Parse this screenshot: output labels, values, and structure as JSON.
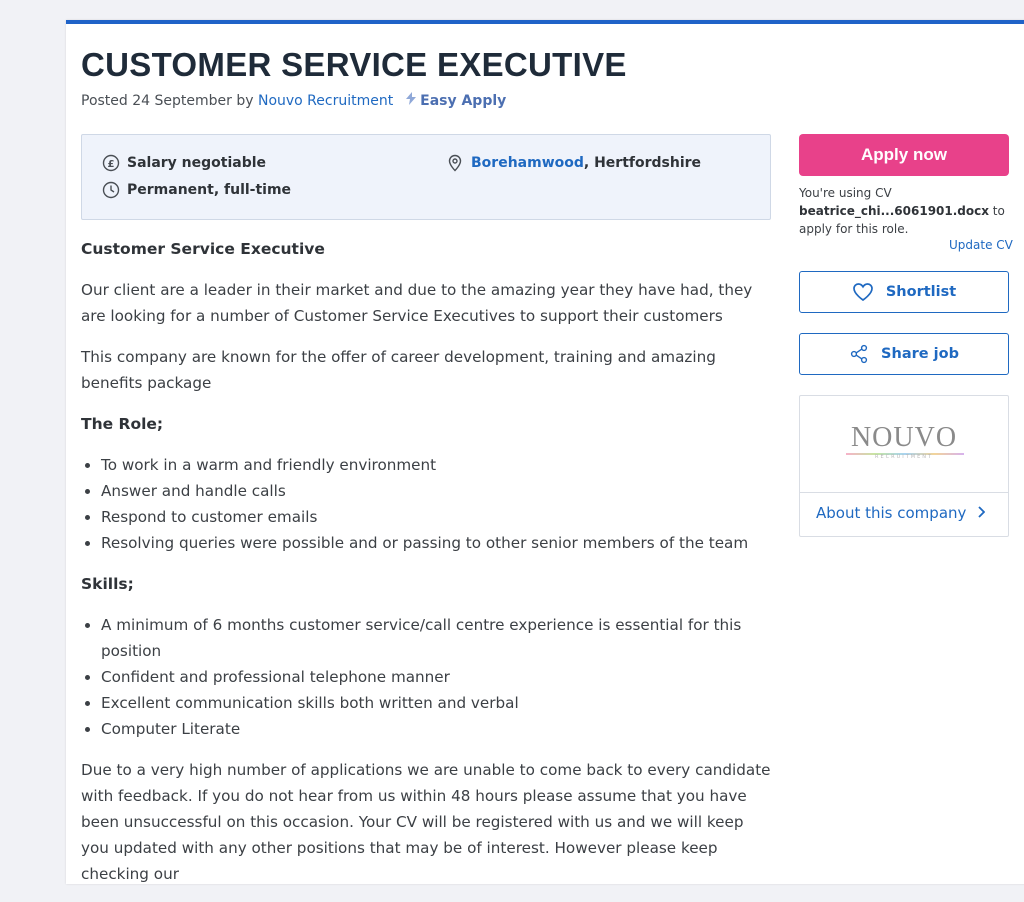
{
  "job": {
    "title": "CUSTOMER SERVICE EXECUTIVE",
    "posted_prefix": "Posted 24 September by ",
    "recruiter": "Nouvo Recruitment",
    "easy_apply": "Easy Apply"
  },
  "summary": {
    "salary": "Salary negotiable",
    "contract": "Permanent, full-time",
    "location_town": "Borehamwood",
    "location_region": ", Hertfordshire"
  },
  "description": {
    "heading": "Customer Service Executive",
    "intro": "Our client are a leader in their market and due to the amazing year they have had, they are looking for a number of Customer Service Executives to support their customers",
    "company_para": "This company are known for the offer of career development, training and amazing benefits package",
    "role_heading": "The Role;",
    "role_items": [
      "To work in a warm and friendly environment",
      "Answer and handle calls",
      "Respond to customer emails",
      "Resolving queries were possible and or passing to other senior members of the team"
    ],
    "skills_heading": "Skills;",
    "skills_items": [
      "A minimum of 6 months customer service/call centre experience is essential for this position",
      "Confident and professional telephone manner",
      "Excellent communication skills both written and verbal",
      "Computer Literate"
    ],
    "closing": "Due to a very high number of applications we are unable to come back to every candidate with feedback. If you do not hear from us within 48 hours please assume that you have been unsuccessful on this occasion. Your CV will be registered with us and we will keep you updated with any other positions that may be of interest. However please keep checking our"
  },
  "sidebar": {
    "apply_label": "Apply now",
    "cv_prefix": "You're using CV ",
    "cv_file": "beatrice_chi...6061901.docx",
    "cv_suffix": " to apply for this role.",
    "update_cv": "Update CV",
    "shortlist_label": "Shortlist",
    "share_label": "Share job",
    "company_logo_text": "NOUVO",
    "company_logo_sub": "RECRUITMENT",
    "about_company": "About this company"
  },
  "icons": {
    "salary": "pound-circle-icon",
    "contract": "clock-icon",
    "location": "map-pin-icon",
    "easy_apply": "lightning-bolt-icon",
    "shortlist": "heart-icon",
    "share": "share-icon",
    "about": "chevron-right-icon"
  },
  "colors": {
    "accent": "#1f63c8",
    "apply_button": "#e8418a",
    "link": "#1f69c1",
    "summary_bg": "#eff3fb"
  }
}
